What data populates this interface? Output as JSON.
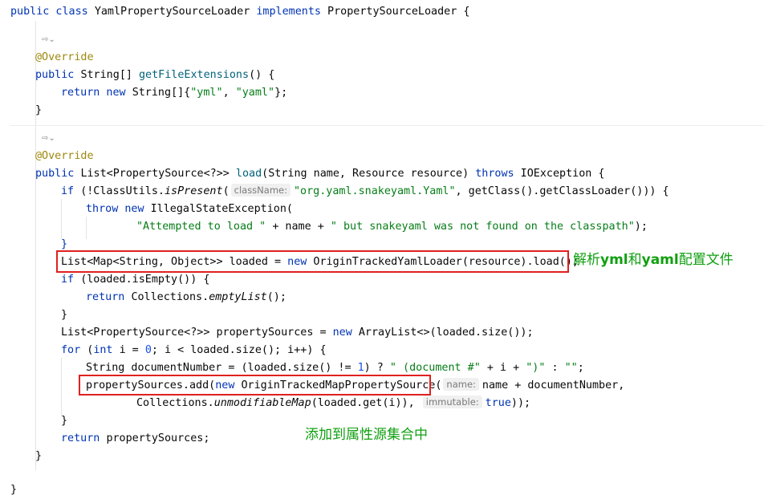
{
  "gutter": {
    "icon_label": "⇨⌄"
  },
  "code": {
    "l1": {
      "a": "public class ",
      "b": "YamlPropertySourceLoader ",
      "c": "implements ",
      "d": "PropertySourceLoader ",
      "e": "{"
    },
    "l3": "@Override",
    "l4": {
      "a": "public ",
      "b": "String",
      "c": "[] ",
      "d": "getFileExtensions",
      "e": "() {"
    },
    "l5": {
      "a": "return new ",
      "b": "String",
      "c": "[]{",
      "d": "\"yml\"",
      "e": ", ",
      "f": "\"yaml\"",
      "g": "};"
    },
    "l6": "}",
    "l8": "@Override",
    "l9": {
      "a": "public ",
      "b": "List<PropertySource<?>> ",
      "c": "load",
      "d": "(String name, Resource resource) ",
      "e": "throws ",
      "f": "IOException {"
    },
    "l10": {
      "a": "if ",
      "b": "(!ClassUtils.",
      "c": "isPresent",
      "d": "(",
      "hint": "className:",
      "e": "\"org.yaml.snakeyaml.Yaml\"",
      "f": ", getClass().getClassLoader())) {"
    },
    "l11": {
      "a": "throw new ",
      "b": "IllegalStateException("
    },
    "l12": {
      "a": "\"Attempted to load \" ",
      "b": "+ name + ",
      "c": "\" but snakeyaml was not found on the classpath\"",
      "d": ");"
    },
    "l13": "}",
    "l14": {
      "a": "List<Map<String, Object>> loaded = ",
      "b": "new ",
      "c": "OriginTrackedYamlLoader(resource).load();"
    },
    "l15": {
      "a": "if ",
      "b": "(loaded.isEmpty()) {"
    },
    "l16": {
      "a": "return ",
      "b": "Collections.",
      "c": "emptyList",
      "d": "();"
    },
    "l17": "}",
    "l18": {
      "a": "List<PropertySource<?>> propertySources = ",
      "b": "new ",
      "c": "ArrayList<>(loaded.size());"
    },
    "l19": {
      "a": "for ",
      "b": "(",
      "c": "int ",
      "d": "i = ",
      "e": "0",
      "f": "; i < loaded.size(); i++) {"
    },
    "l20": {
      "a": "String documentNumber = (loaded.size() != ",
      "b": "1",
      "c": ") ? ",
      "d": "\" (document #\" ",
      "e": "+ i + ",
      "f": "\")\" ",
      "g": ": ",
      "h": "\"\"",
      "i": ";"
    },
    "l21": {
      "a": "propertySources.add(",
      "b": "new ",
      "c": "OriginTrackedMapPropertySource(",
      "hint": "name:",
      "d": "name + documentNumber,"
    },
    "l22": {
      "a": "Collections.",
      "b": "unmodifiableMap",
      "c": "(loaded.get(i)), ",
      "hint": "immutable:",
      "d": "true",
      "e": "));"
    },
    "l23": "}",
    "l24": {
      "a": "return ",
      "b": "propertySources;"
    },
    "l25": "}",
    "l27": "}"
  },
  "annotations": {
    "note1": {
      "p1": "解析",
      "p2": "yml",
      "p3": "和",
      "p4": "yaml",
      "p5": "配置文件"
    },
    "note2": "添加到属性源集合中",
    "color_box": "#e02020",
    "color_note": "#10a010"
  }
}
